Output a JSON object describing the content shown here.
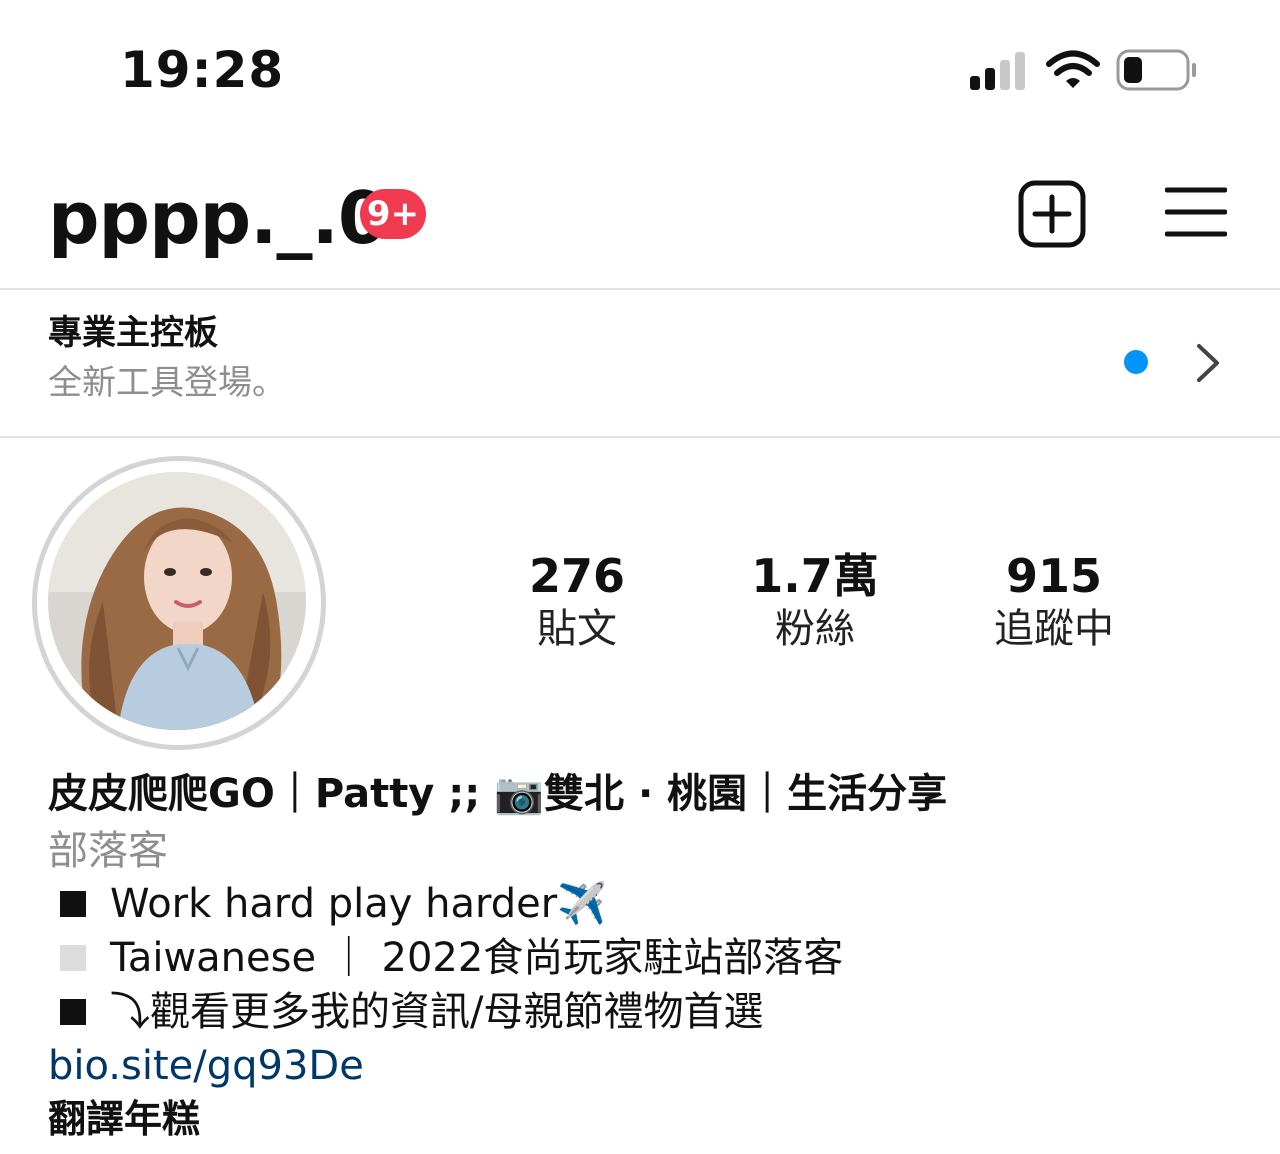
{
  "status_bar": {
    "time": "19:28",
    "icons": [
      "signal-icon",
      "wifi-icon",
      "battery-icon"
    ]
  },
  "header": {
    "username": "pppp._.0",
    "notification_badge": "9+",
    "icons": [
      "add-post-icon",
      "menu-icon"
    ]
  },
  "dashboard": {
    "title": "專業主控板",
    "subtitle": "全新工具登場。",
    "icons": [
      "chevron-right-icon"
    ]
  },
  "profile": {
    "stats": [
      {
        "value": "276",
        "label": "貼文"
      },
      {
        "value": "1.7萬",
        "label": "粉絲"
      },
      {
        "value": "915",
        "label": "追蹤中"
      }
    ]
  },
  "bio": {
    "name": "皮皮爬爬GO｜Patty ;; 📷雙北 · 桃園｜生活分享",
    "category": "部落客",
    "lines": [
      {
        "text": "Work hard play harder✈️",
        "marker": "black-square"
      },
      {
        "text": "Taiwanese ｜ 2022食尚玩家駐站部落客",
        "marker": "white-square"
      },
      {
        "text": "⤵觀看更多我的資訊/母親節禮物首選",
        "marker": "black-square"
      }
    ],
    "link": "bio.site/gq93De",
    "translate": "翻譯年糕"
  },
  "colors": {
    "badge": "#ef3a4f",
    "dot": "#0095f6",
    "link": "#00376b",
    "muted": "#8e8e8e"
  }
}
